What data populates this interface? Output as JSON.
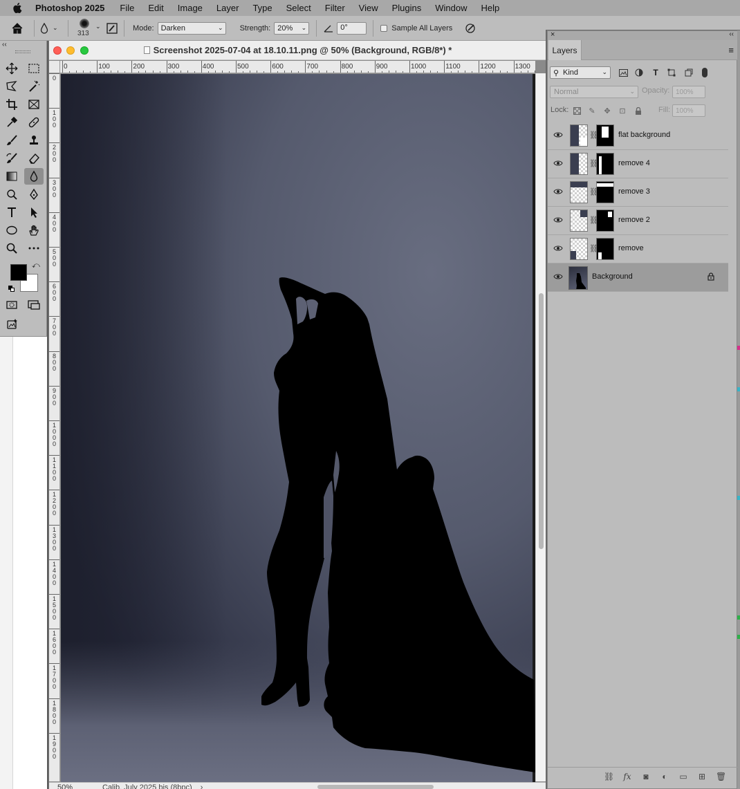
{
  "menubar": {
    "items": [
      "Photoshop 2025",
      "File",
      "Edit",
      "Image",
      "Layer",
      "Type",
      "Select",
      "Filter",
      "View",
      "Plugins",
      "Window",
      "Help"
    ]
  },
  "options": {
    "brush_size": "313",
    "mode_label": "Mode:",
    "mode_value": "Darken",
    "strength_label": "Strength:",
    "strength_value": "20%",
    "angle_value": "0°",
    "sample_all_label": "Sample All Layers"
  },
  "document": {
    "title": "Screenshot 2025-07-04 at 18.10.11.png @ 50% (Background, RGB/8*) *",
    "zoom": "50%",
    "status_info": "Calib. July 2025 bis (8bpc)",
    "status_arrow": "›",
    "h_ruler": [
      "0",
      "100",
      "200",
      "300",
      "400",
      "500",
      "600",
      "700",
      "800",
      "900",
      "1000",
      "1100",
      "1200",
      "1300"
    ],
    "v_ruler": [
      "0",
      "1\n0\n0",
      "2\n0\n0",
      "3\n0\n0",
      "4\n0\n0",
      "5\n0\n0",
      "6\n0\n0",
      "7\n0\n0",
      "8\n0\n0",
      "9\n0\n0",
      "1\n0\n0\n0",
      "1\n1\n0\n0",
      "1\n2\n0\n0",
      "1\n3\n0\n0",
      "1\n4\n0\n0",
      "1\n5\n0\n0",
      "1\n6\n0\n0",
      "1\n7\n0\n0",
      "1\n8\n0\n0",
      "1\n9\n0\n0"
    ]
  },
  "layers_panel": {
    "tab": "Layers",
    "kind_filter": "Kind",
    "blend_mode": "Normal",
    "opacity_label": "Opacity:",
    "opacity_value": "100%",
    "lock_label": "Lock:",
    "fill_label": "Fill:",
    "fill_value": "100%",
    "layers": [
      {
        "name": "flat background",
        "visible": true
      },
      {
        "name": "remove 4",
        "visible": true
      },
      {
        "name": "remove 3",
        "visible": true
      },
      {
        "name": "remove 2",
        "visible": true
      },
      {
        "name": "remove",
        "visible": true
      },
      {
        "name": "Background",
        "visible": true,
        "locked": true,
        "selected": true
      }
    ]
  },
  "colors": {
    "foreground": "#000000",
    "background": "#ffffff",
    "accent_close": "#ff5f57",
    "accent_minimize": "#febc2e",
    "accent_zoom": "#28c840"
  }
}
